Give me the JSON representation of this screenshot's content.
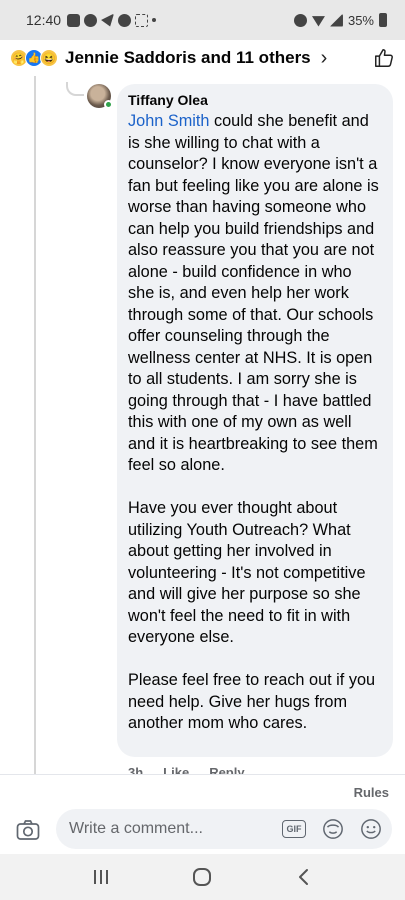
{
  "status_bar": {
    "time": "12:40",
    "battery": "35%"
  },
  "header": {
    "title": "Jennie Saddoris and 11 others",
    "reactions": [
      "care-reaction-icon",
      "like-reaction-icon",
      "haha-reaction-icon"
    ]
  },
  "comment": {
    "author": "Tiffany Olea",
    "mention": "John Smith",
    "body": " could she benefit and is she willing to chat with a counselor? I know everyone isn't a fan but feeling like you are alone is worse than having someone who can help you build friendships and also reassure you that you are not alone - build confidence in who she is, and even help her work through some of that. Our schools offer counseling through the wellness center at NHS. It is open to all students. I am sorry she is going through that - I have battled this with one of my own as well and it is heartbreaking to see them feel so alone.\n\nHave you ever thought about utilizing Youth Outreach? What about getting her involved in volunteering - It's not competitive and will give her purpose so she won't feel the need to fit in with everyone else.\n\nPlease feel free to reach out if you need help. Give her hugs from another mom who cares.",
    "time_ago": "3h",
    "like_label": "Like",
    "reply_label": "Reply"
  },
  "composer": {
    "rules_label": "Rules",
    "placeholder": "Write a comment...",
    "gif_label": "GIF"
  },
  "colors": {
    "mention": "#1b62c9",
    "bubble": "#f0f2f5",
    "online": "#31a24c"
  }
}
